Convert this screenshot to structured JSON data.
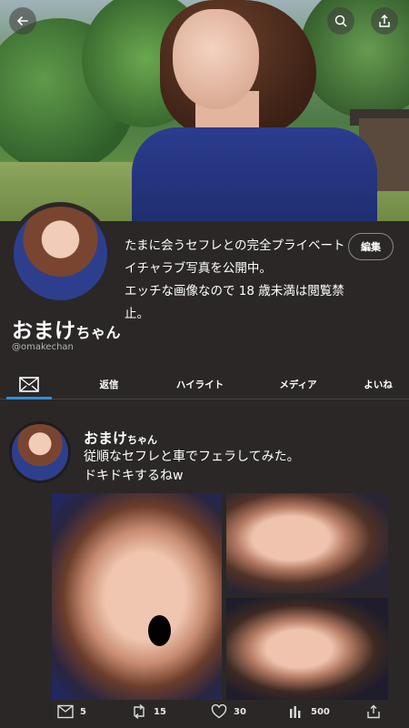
{
  "header": {
    "back_icon": "arrow-left-icon",
    "search_icon": "search-icon",
    "share_icon": "share-icon"
  },
  "profile": {
    "bio_lines": [
      "たまに会うセフレとの完全プライベート",
      "イチャラブ写真を公開中。",
      "エッチな画像なので 18 歳未満は閲覧禁止。"
    ],
    "edit_label": "編集",
    "name": "おまけ",
    "name_suffix": "ちゃん",
    "handle": "@omakechan"
  },
  "tabs": {
    "icon": "mail-icon",
    "items": [
      "返信",
      "ハイライト",
      "メディア",
      "よいね"
    ]
  },
  "post": {
    "name": "おまけ",
    "name_suffix": "ちゃん",
    "text_lines": [
      "従順なセフレと車でフェラしてみた。",
      "ドキドキするねw"
    ]
  },
  "actions": {
    "replies": "5",
    "retweets": "15",
    "likes": "30",
    "views": "500"
  },
  "colors": {
    "background": "#2b2727",
    "accent": "#2e8fe0"
  }
}
